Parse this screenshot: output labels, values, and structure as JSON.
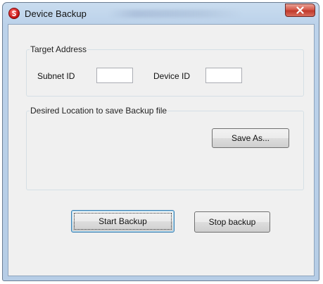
{
  "window": {
    "title": "Device Backup",
    "close_glyph": "✕"
  },
  "target_address": {
    "legend": "Target Address",
    "subnet_label": "Subnet ID",
    "subnet_value": "",
    "device_label": "Device ID",
    "device_value": ""
  },
  "location": {
    "legend": "Desired Location to save Backup file",
    "save_as_label": "Save As..."
  },
  "actions": {
    "start_label": "Start Backup",
    "stop_label": "Stop backup"
  },
  "colors": {
    "close_button": "#c0392b",
    "app_icon": "#d11a1a",
    "dialog_background": "#f0f0f0"
  },
  "icons": {
    "app": "s-logo-icon",
    "close": "close-icon"
  }
}
